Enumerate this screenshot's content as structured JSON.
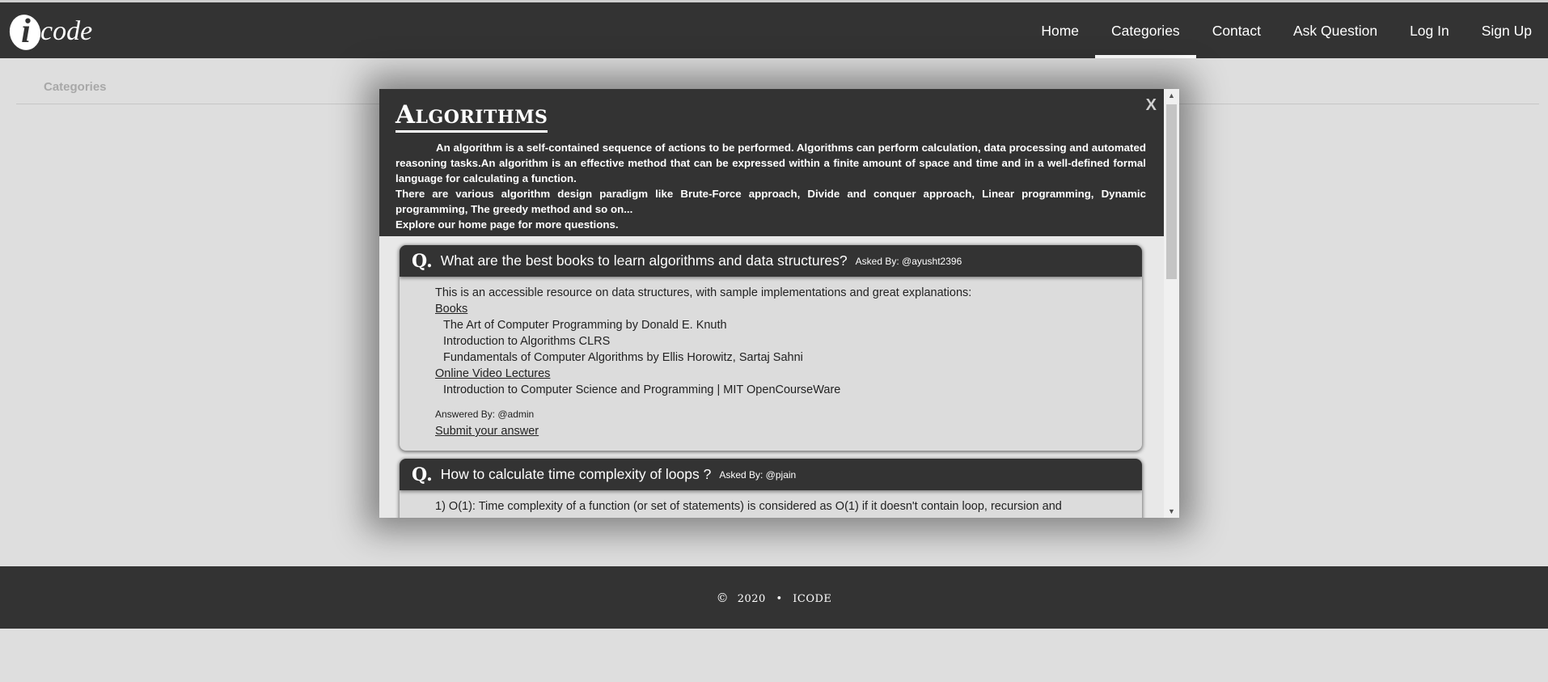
{
  "brand": {
    "logo_letter": "i",
    "logo_text": "code"
  },
  "nav": {
    "items": [
      "Home",
      "Categories",
      "Contact",
      "Ask Question",
      "Log In",
      "Sign Up"
    ],
    "active": "Categories"
  },
  "breadcrumb": "Categories",
  "modal": {
    "title": "Algorithms",
    "close_label": "X",
    "description": [
      "An algorithm is a self-contained sequence of actions to be performed. Algorithms can perform calculation, data processing and automated reasoning tasks.An algorithm is an effective method that can be expressed within a finite amount of space and time and in a well-defined formal language for calculating a function.",
      "There are various algorithm design paradigm like Brute-Force approach, Divide and conquer approach, Linear programming, Dynamic programming, The greedy method and so on...",
      "Explore our home page for more questions."
    ],
    "questions": [
      {
        "mark": "Q.",
        "question": "What are the best books to learn algorithms and data structures?",
        "asked_by": "Asked By: @ayusht2396",
        "intro": "This is an accessible resource on data structures, with sample implementations and great explanations:",
        "books_label": "Books",
        "books": [
          "The Art of Computer Programming by Donald E. Knuth",
          "Introduction to Algorithms CLRS",
          "Fundamentals of Computer Algorithms by Ellis Horowitz, Sartaj Sahni"
        ],
        "videos_label": "Online Video Lectures",
        "videos": [
          "Introduction to Computer Science and Programming | MIT OpenCourseWare"
        ],
        "answered_by": "Answered By: @admin",
        "submit_label": "Submit your answer"
      },
      {
        "mark": "Q.",
        "question": "How to calculate time complexity of loops ?",
        "asked_by": "Asked By: @pjain",
        "answer_start": "1) O(1): Time complexity of a function (or set of statements) is considered as O(1) if it doesn't contain loop, recursion and"
      }
    ]
  },
  "scrollbar": {
    "up": "▲",
    "down": "▼"
  },
  "footer": {
    "copyright_symbol": "©",
    "year": "2020",
    "separator": "•",
    "brand": "ICODE"
  }
}
